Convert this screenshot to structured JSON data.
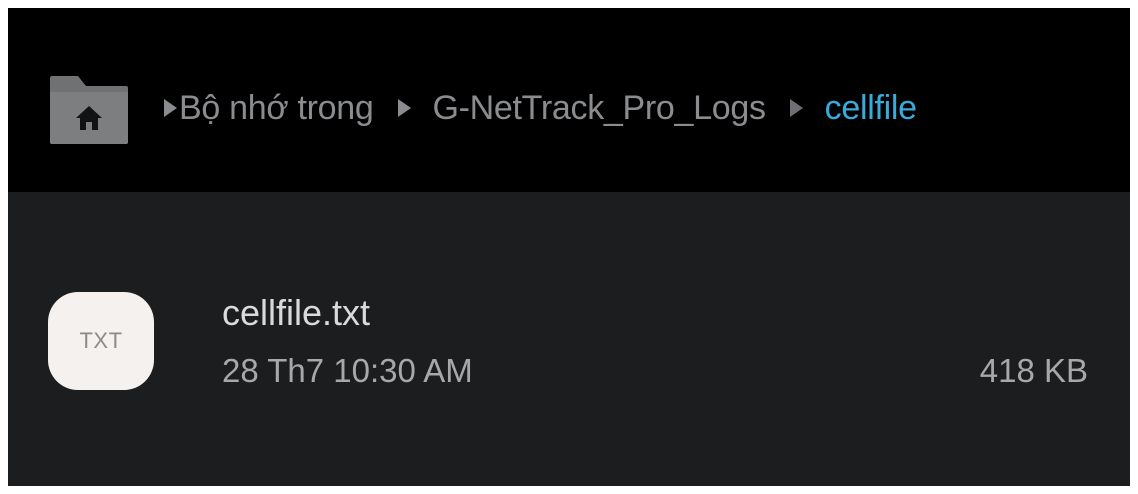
{
  "breadcrumb": {
    "items": [
      {
        "label": "Bộ nhớ trong"
      },
      {
        "label": "G-NetTrack_Pro_Logs"
      },
      {
        "label": "cellfile"
      }
    ],
    "current_color": "#3aa9dc"
  },
  "icons": {
    "home": "folder-home-icon",
    "file": "txt-file-icon",
    "separator": "triangle-right-icon"
  },
  "files": [
    {
      "icon_label": "TXT",
      "name": "cellfile.txt",
      "modified": "28 Th7 10:30 AM",
      "size": "418 KB"
    }
  ],
  "colors": {
    "background": "#1b1d1f",
    "header": "#000000",
    "text_primary": "#d9dadb",
    "text_secondary": "#a6a8aa"
  }
}
